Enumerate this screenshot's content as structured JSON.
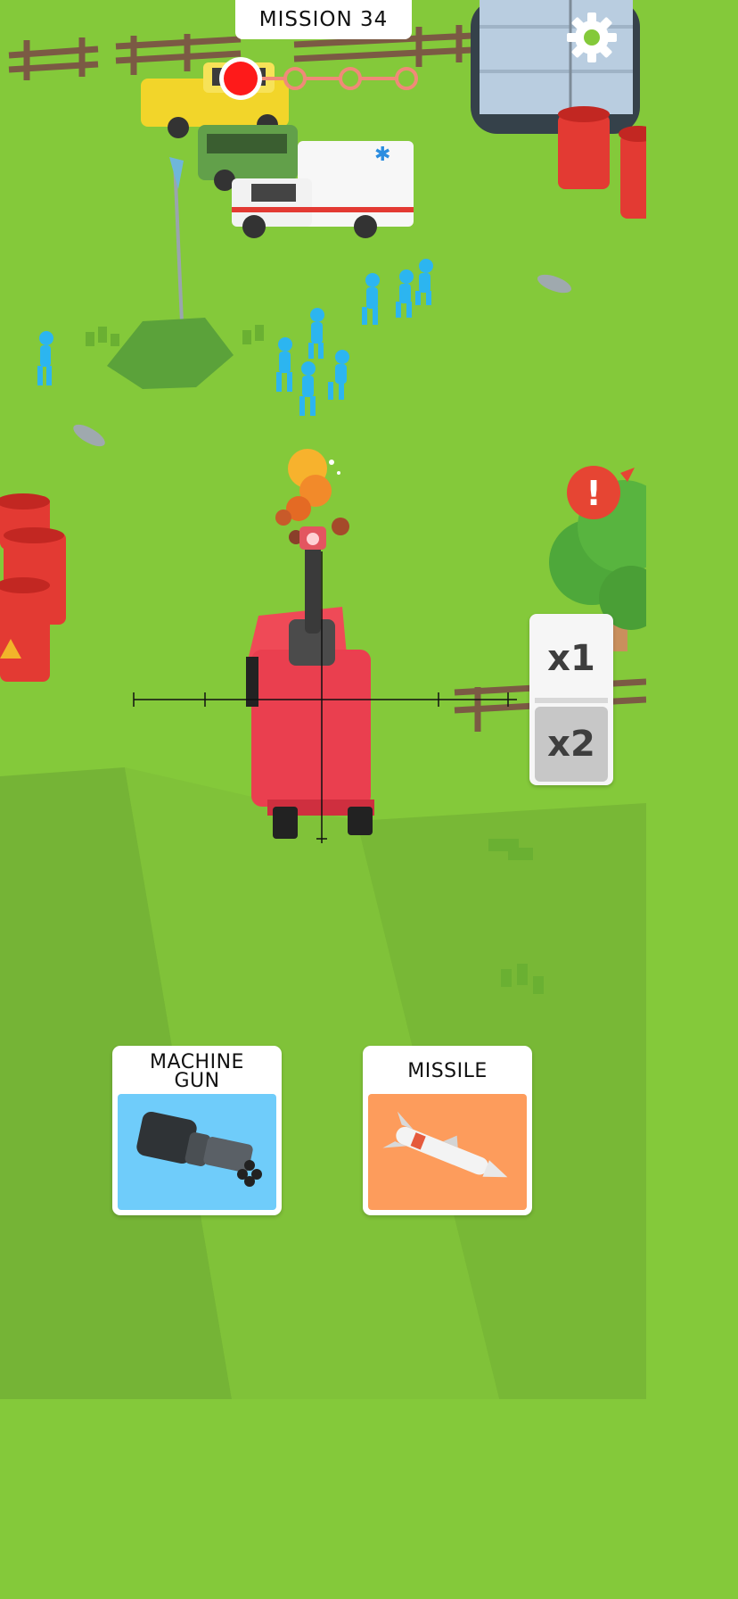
{
  "mission": {
    "label": "MISSION 34"
  },
  "progress": {
    "current_stage": 1,
    "total_stages": 4,
    "active_color": "#fe1a1a",
    "inactive_color": "#f08a78"
  },
  "alert": {
    "glyph": "!",
    "color": "#e64533"
  },
  "zoom": {
    "options": [
      "x1",
      "x2"
    ],
    "selected": "x2"
  },
  "weapons": [
    {
      "label": "MACHINE\nGUN",
      "icon": "minigun-icon",
      "bg_color": "#6fccfa"
    },
    {
      "label": "MISSILE",
      "icon": "missile-icon",
      "bg_color": "#fd9c5c"
    }
  ],
  "colors": {
    "grass": "#84c93a",
    "grass_dark": "#6fad33",
    "truck": "#ea3f4f",
    "enemy": "#2cb5f0",
    "barrel": "#e33a33"
  }
}
